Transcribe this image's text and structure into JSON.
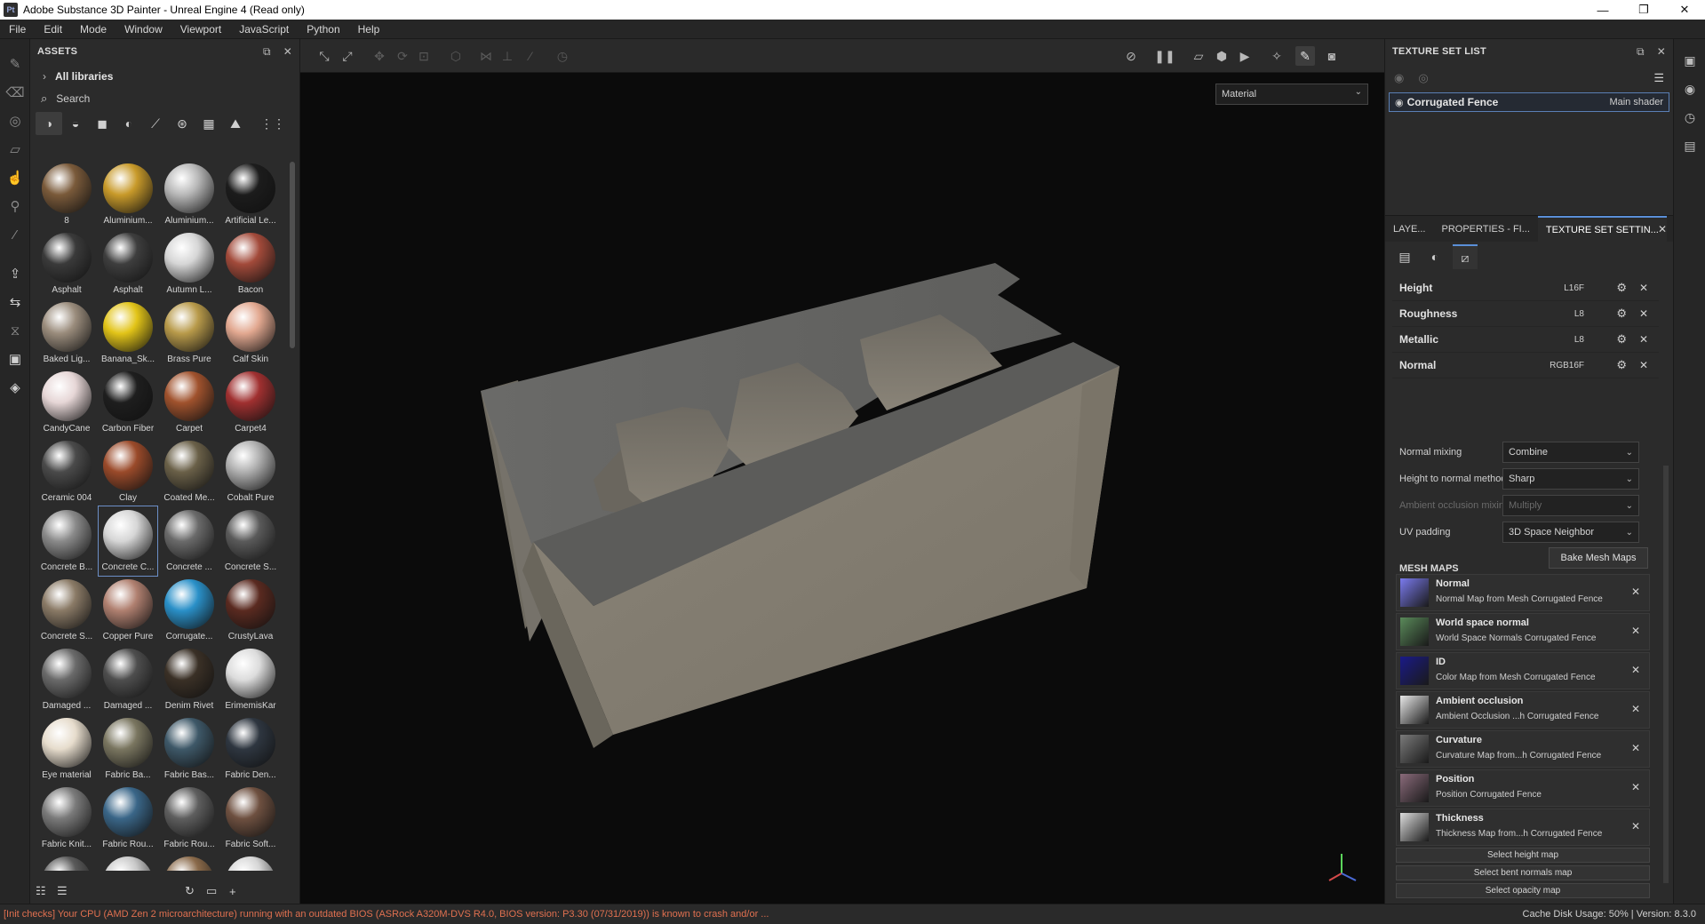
{
  "window": {
    "app_icon": "Pt",
    "title": "Adobe Substance 3D Painter - Unreal Engine 4 (Read only)",
    "minimize": "—",
    "maximize": "❐",
    "close": "✕"
  },
  "menu": [
    "File",
    "Edit",
    "Mode",
    "Window",
    "Viewport",
    "JavaScript",
    "Python",
    "Help"
  ],
  "left_tools": [
    "paint-brush-icon",
    "eraser-icon",
    "projection-icon",
    "polygon-fill-icon",
    "smudge-icon",
    "clone-stamp-icon",
    "color-picker-icon",
    "export-icon",
    "bake-icon",
    "resize-icon",
    "render-icon",
    "shelf-icon"
  ],
  "assets": {
    "title": "ASSETS",
    "libraries_label": "All libraries",
    "search_label": "Search",
    "items": [
      {
        "label": "8",
        "color": "#7a5a3a"
      },
      {
        "label": "Aluminium...",
        "color": "#c89a2a"
      },
      {
        "label": "Aluminium...",
        "color": "#b8b8b8"
      },
      {
        "label": "Artificial Le...",
        "color": "#1c1c1c"
      },
      {
        "label": "Asphalt",
        "color": "#3a3a3a"
      },
      {
        "label": "Asphalt",
        "color": "#3e3e3e"
      },
      {
        "label": "Autumn L...",
        "color": "#d6d6d6"
      },
      {
        "label": "Bacon",
        "color": "#a24a3a"
      },
      {
        "label": "Baked Lig...",
        "color": "#9a8c7c"
      },
      {
        "label": "Banana_Sk...",
        "color": "#e2c418"
      },
      {
        "label": "Brass Pure",
        "color": "#b89a4a"
      },
      {
        "label": "Calf Skin",
        "color": "#e2a890"
      },
      {
        "label": "CandyCane",
        "color": "#e6d6d6"
      },
      {
        "label": "Carbon Fiber",
        "color": "#1e1e1e"
      },
      {
        "label": "Carpet",
        "color": "#a0522d"
      },
      {
        "label": "Carpet4",
        "color": "#a03030"
      },
      {
        "label": "Ceramic 004",
        "color": "#4a4a4a"
      },
      {
        "label": "Clay",
        "color": "#9a4a2a"
      },
      {
        "label": "Coated Me...",
        "color": "#6a6048"
      },
      {
        "label": "Cobalt Pure",
        "color": "#b0b0b0"
      },
      {
        "label": "Concrete B...",
        "color": "#8a8a8a"
      },
      {
        "label": "Concrete C...",
        "color": "#d6d6d6"
      },
      {
        "label": "Concrete ...",
        "color": "#6a6a6a"
      },
      {
        "label": "Concrete S...",
        "color": "#5a5a5a"
      },
      {
        "label": "Concrete S...",
        "color": "#8a7a66"
      },
      {
        "label": "Copper Pure",
        "color": "#b08070"
      },
      {
        "label": "Corrugate...",
        "color": "#2a90c8"
      },
      {
        "label": "CrustyLava",
        "color": "#5a2a20"
      },
      {
        "label": "Damaged ...",
        "color": "#6a6a6a"
      },
      {
        "label": "Damaged ...",
        "color": "#4e4e4e"
      },
      {
        "label": "Denim Rivet",
        "color": "#3a3026"
      },
      {
        "label": "ErimemisKar",
        "color": "#dcdcdc"
      },
      {
        "label": "Eye material",
        "color": "#e6dccc"
      },
      {
        "label": "Fabric Ba...",
        "color": "#7a7660"
      },
      {
        "label": "Fabric Bas...",
        "color": "#3e5868"
      },
      {
        "label": "Fabric Den...",
        "color": "#2e3640"
      },
      {
        "label": "Fabric Knit...",
        "color": "#7a7a7a"
      },
      {
        "label": "Fabric Rou...",
        "color": "#3a6688"
      },
      {
        "label": "Fabric Rou...",
        "color": "#5e5e5e"
      },
      {
        "label": "Fabric Soft...",
        "color": "#6e5040"
      },
      {
        "label": "",
        "color": "#5a5a5a"
      },
      {
        "label": "",
        "color": "#c8c8c8"
      },
      {
        "label": "",
        "color": "#8a6a4a"
      },
      {
        "label": "",
        "color": "#d6d6d6"
      }
    ]
  },
  "viewport": {
    "mode_select": "Material"
  },
  "texture_set_list": {
    "title": "TEXTURE SET LIST",
    "set_name": "Corrugated Fence",
    "shader": "Main shader"
  },
  "tabs": [
    "LAYE...",
    "PROPERTIES - FI...",
    "TEXTURE SET SETTIN..."
  ],
  "channels": [
    {
      "name": "Height",
      "format": "L16F"
    },
    {
      "name": "Roughness",
      "format": "L8"
    },
    {
      "name": "Metallic",
      "format": "L8"
    },
    {
      "name": "Normal",
      "format": "RGB16F"
    }
  ],
  "settings": [
    {
      "label": "Normal mixing",
      "value": "Combine",
      "disabled": false
    },
    {
      "label": "Height to normal method",
      "value": "Sharp",
      "disabled": false
    },
    {
      "label": "Ambient occlusion mixing",
      "value": "Multiply",
      "disabled": true
    },
    {
      "label": "UV padding",
      "value": "3D Space Neighbor",
      "disabled": false
    }
  ],
  "mesh_maps": {
    "title": "MESH MAPS",
    "bake_button": "Bake Mesh Maps",
    "items": [
      {
        "name": "Normal",
        "desc": "Normal Map from Mesh Corrugated Fence",
        "color": "#7a7aee"
      },
      {
        "name": "World space normal",
        "desc": "World Space Normals Corrugated Fence",
        "color": "#5a8a5a"
      },
      {
        "name": "ID",
        "desc": "Color Map from Mesh Corrugated Fence",
        "color": "#1a1a88"
      },
      {
        "name": "Ambient occlusion",
        "desc": "Ambient Occlusion ...h Corrugated Fence",
        "color": "#e8e8e8"
      },
      {
        "name": "Curvature",
        "desc": "Curvature Map from...h Corrugated Fence",
        "color": "#7a7a7a"
      },
      {
        "name": "Position",
        "desc": "Position Corrugated Fence",
        "color": "#8a6a7a"
      },
      {
        "name": "Thickness",
        "desc": "Thickness Map from...h Corrugated Fence",
        "color": "#dcdcdc"
      }
    ],
    "select_buttons": [
      "Select height map",
      "Select bent normals map",
      "Select opacity map"
    ]
  },
  "status": {
    "warning": "[Init checks] Your CPU (AMD Zen 2 microarchitecture) running with an outdated BIOS (ASRock A320M-DVS R4.0, BIOS version: P3.30 (07/31/2019)) is known to crash and/or ...",
    "right": "Cache Disk Usage:   50% | Version: 8.3.0"
  }
}
